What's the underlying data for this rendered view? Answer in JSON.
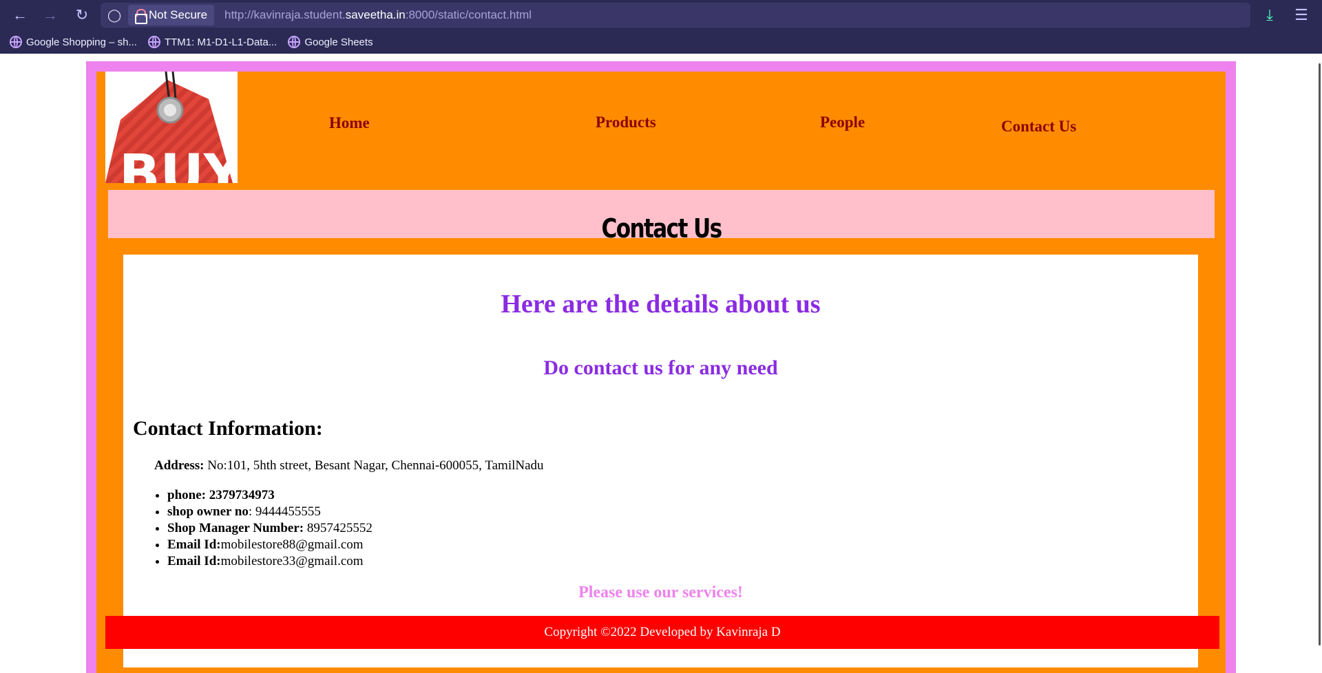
{
  "browser": {
    "security_label": "Not Secure",
    "url_prefix": "http://kavinraja.student.",
    "url_domain": "saveetha.in",
    "url_suffix": ":8000/static/contact.html",
    "bookmarks": [
      {
        "label": "Google Shopping – sh...",
        "icon": "globe-icon"
      },
      {
        "label": "TTM1: M1-D1-L1-Data...",
        "icon": "globe-icon"
      },
      {
        "label": "Google Sheets",
        "icon": "globe-icon"
      }
    ]
  },
  "logo": {
    "text": "BUY"
  },
  "nav": {
    "home": "Home",
    "products": "Products",
    "people": "People",
    "contact": "Contact Us"
  },
  "banner": {
    "title": "Contact Us"
  },
  "content": {
    "heading_about": "Here are the details about us",
    "heading_contact": "Do contact us for any need",
    "heading_info": "Contact Information:",
    "address_label": "Address:",
    "address_value": " No:101, 5hth street, Besant Nagar, Chennai-600055, TamilNadu",
    "items": [
      {
        "label": "phone: 2379734973",
        "value": ""
      },
      {
        "label": "shop owner no",
        "value": ": 9444455555"
      },
      {
        "label": "Shop Manager Number:",
        "value": " 8957425552"
      },
      {
        "label": "Email Id:",
        "value": "mobilestore88@gmail.com"
      },
      {
        "label": "Email Id:",
        "value": "mobilestore33@gmail.com"
      }
    ],
    "closing": "Please use our services!"
  },
  "footer": {
    "text": "Copyright ©2022 Developed by Kavinraja D"
  },
  "colors": {
    "outer_border": "#ee82ee",
    "page_bg": "#ff8c00",
    "banner_bg": "#ffc0cb",
    "nav_link": "#8b0000",
    "heading": "#8a2be2",
    "closing": "#ee82ee",
    "footer_bg": "#ff0000"
  }
}
